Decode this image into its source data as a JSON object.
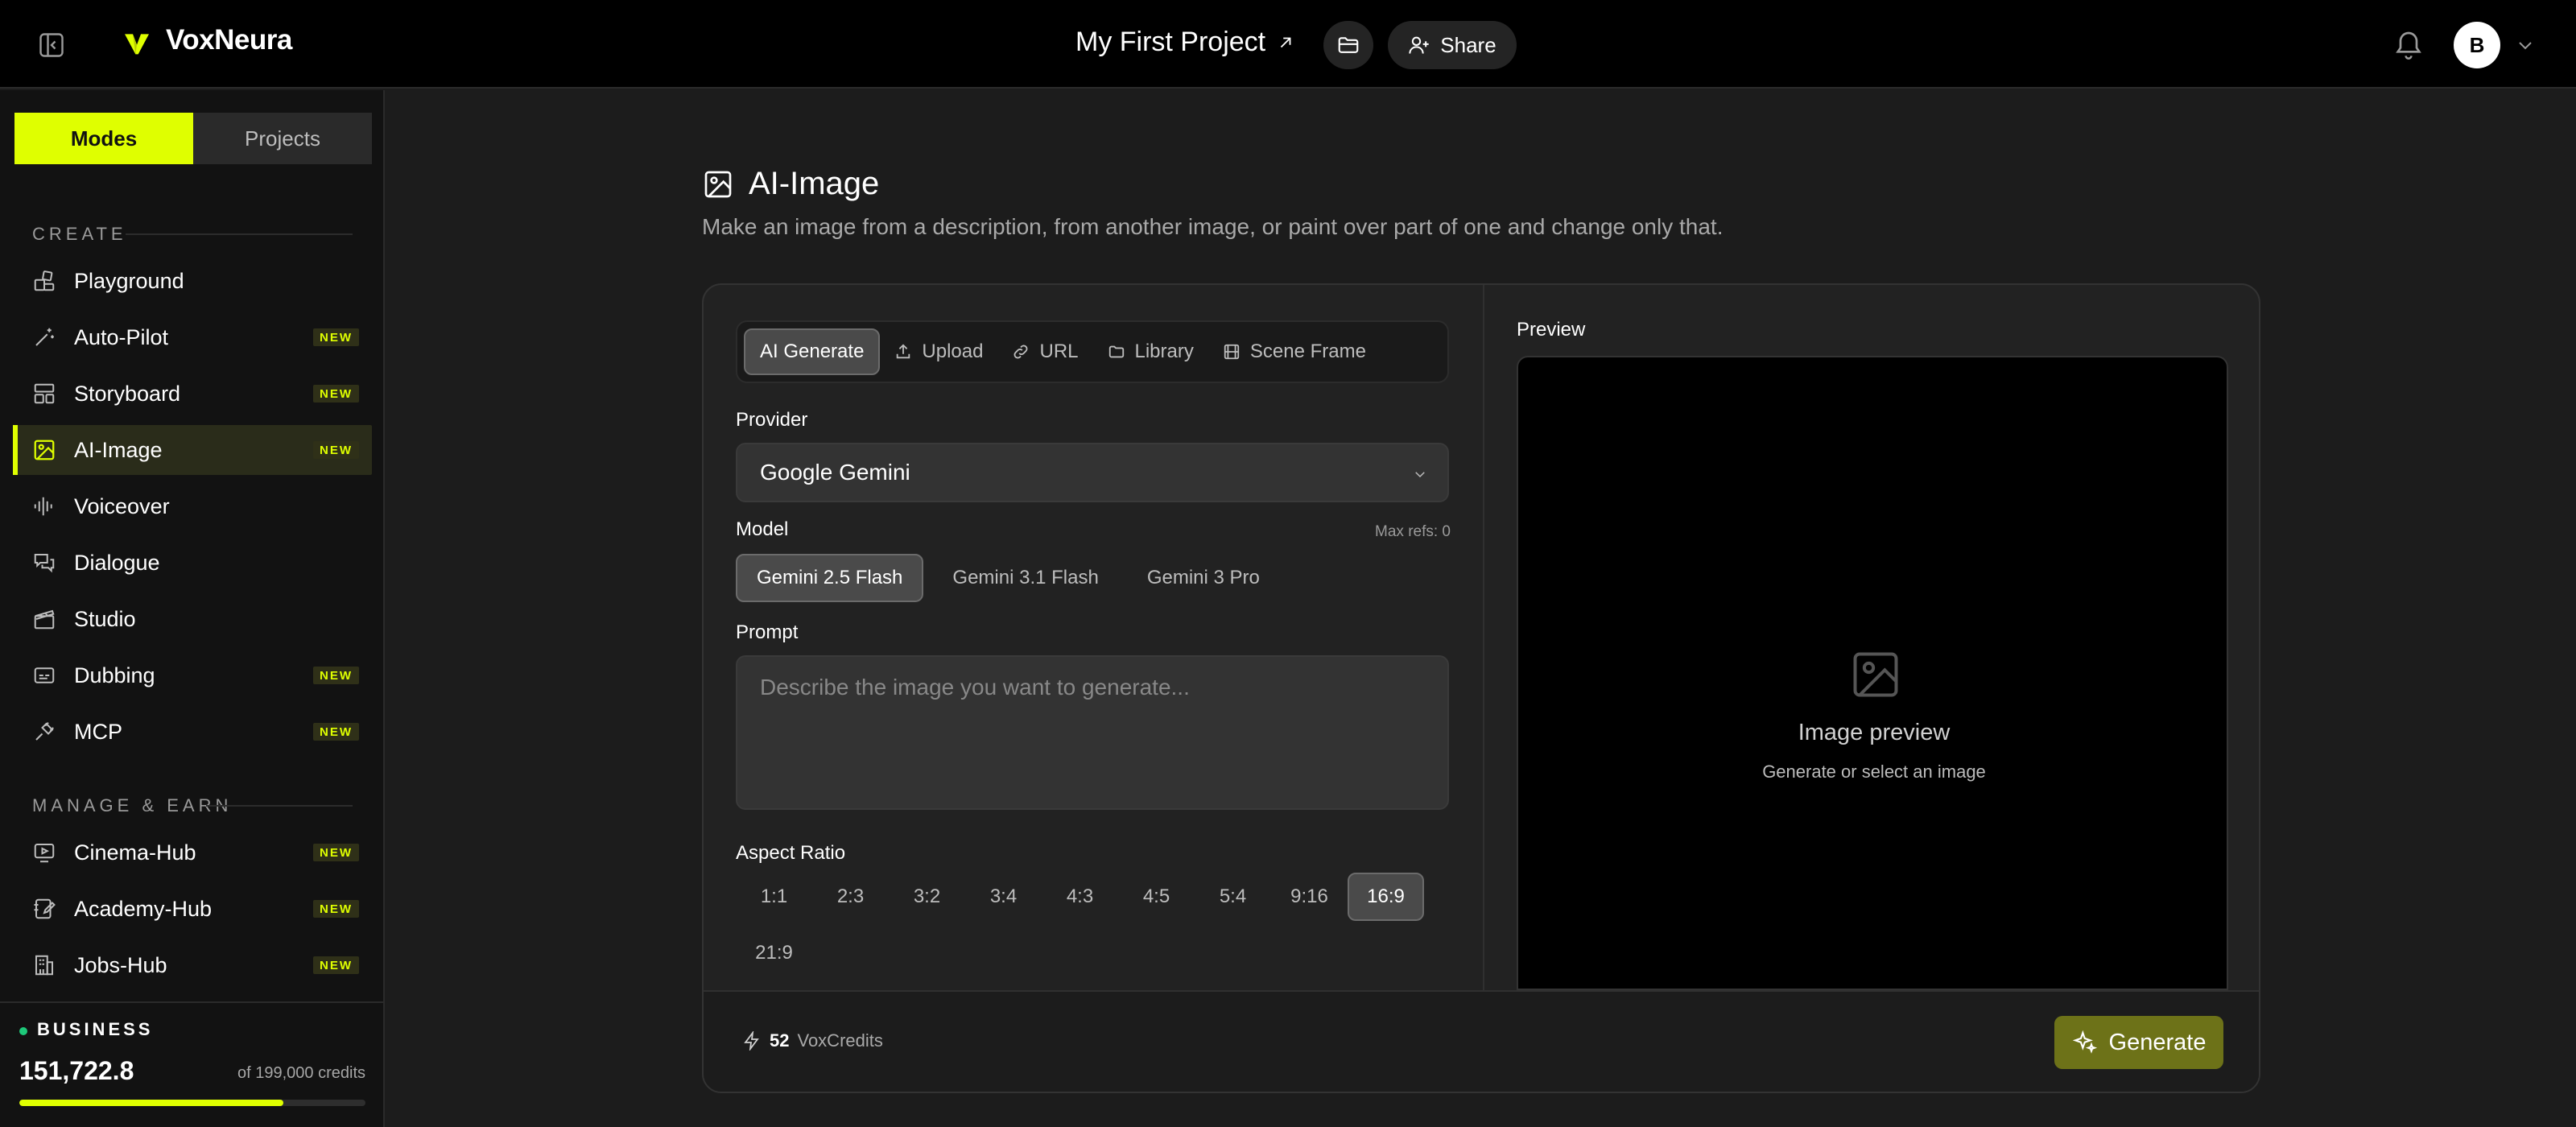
{
  "topbar": {
    "brand": "VoxNeura",
    "project_title": "My First Project",
    "share_label": "Share",
    "avatar_initial": "B"
  },
  "sidebar": {
    "modes_label": "Modes",
    "projects_label": "Projects",
    "create_label": "CREATE",
    "manage_label": "MANAGE & EARN",
    "create_items": [
      {
        "label": "Playground",
        "badge": ""
      },
      {
        "label": "Auto-Pilot",
        "badge": "NEW"
      },
      {
        "label": "Storyboard",
        "badge": "NEW"
      },
      {
        "label": "AI-Image",
        "badge": "NEW"
      },
      {
        "label": "Voiceover",
        "badge": ""
      },
      {
        "label": "Dialogue",
        "badge": ""
      },
      {
        "label": "Studio",
        "badge": ""
      },
      {
        "label": "Dubbing",
        "badge": "NEW"
      },
      {
        "label": "MCP",
        "badge": "NEW"
      }
    ],
    "manage_items": [
      {
        "label": "Cinema-Hub",
        "badge": "NEW"
      },
      {
        "label": "Academy-Hub",
        "badge": "NEW"
      },
      {
        "label": "Jobs-Hub",
        "badge": "NEW"
      }
    ],
    "plan": {
      "name": "BUSINESS",
      "credits": "151,722.8",
      "of_total": "of 199,000 credits",
      "fill_fraction": 0.762
    }
  },
  "main": {
    "title": "AI-Image",
    "subtitle": "Make an image from a description, from another image, or paint over part of one and change only that.",
    "source_tabs": [
      "AI Generate",
      "Upload",
      "URL",
      "Library",
      "Scene Frame"
    ],
    "provider_label": "Provider",
    "provider_value": "Google Gemini",
    "model_label": "Model",
    "max_refs": "Max refs: 0",
    "models": [
      "Gemini 2.5 Flash",
      "Gemini 3.1 Flash",
      "Gemini 3 Pro"
    ],
    "prompt_label": "Prompt",
    "prompt_placeholder": "Describe the image you want to generate...",
    "aspect_label": "Aspect Ratio",
    "aspect_ratios": [
      "1:1",
      "2:3",
      "3:2",
      "3:4",
      "4:3",
      "4:5",
      "5:4",
      "9:16",
      "16:9"
    ],
    "aspect_ratio_extra": "21:9",
    "aspect_selected": "16:9",
    "preview_label": "Preview",
    "preview_title": "Image preview",
    "preview_sub": "Generate or select an image",
    "credits_value": "52",
    "credits_unit": "VoxCredits",
    "generate_label": "Generate"
  },
  "colors": {
    "accent": "#dfff00",
    "generate_button": "#6d7218",
    "status_dot": "#1ec97a"
  }
}
